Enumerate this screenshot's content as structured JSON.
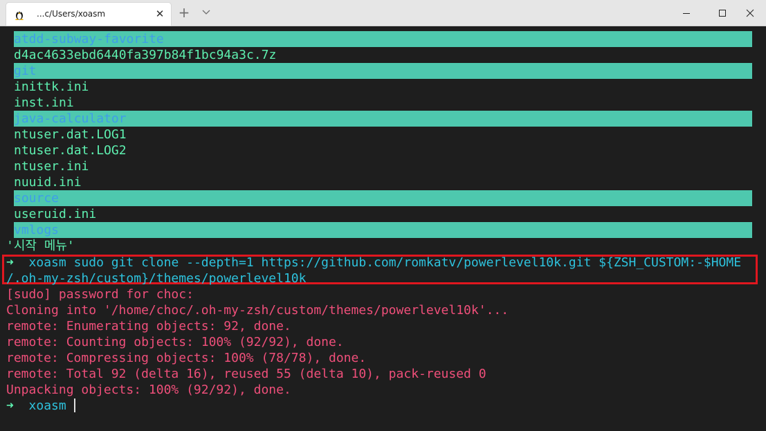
{
  "window": {
    "tab_title": "...c/Users/xoasm",
    "tab_icon": "linux-tux-icon",
    "close_tab_icon": "close-icon",
    "new_tab_symbol": "+",
    "dropdown_icon": "chevron-down-icon",
    "minimize_icon": "minimize-icon",
    "maximize_icon": "maximize-icon",
    "close_window_icon": "close-icon"
  },
  "colors": {
    "terminal_bg": "#1e1e1e",
    "dir_highlight": "#4ec8ae",
    "dir_text": "#3f9ee8",
    "file_text": "#5ef0b0",
    "output_text": "#ef4f7a",
    "prompt_user": "#2ec2dd",
    "annotation_box": "#e0171f"
  },
  "listing": [
    {
      "name": "atdd-subway-favorite",
      "is_dir": true
    },
    {
      "name": "d4ac4633ebd6440fa397b84f1bc94a3c.7z",
      "is_dir": false
    },
    {
      "name": "git",
      "is_dir": true
    },
    {
      "name": "inittk.ini",
      "is_dir": false
    },
    {
      "name": "inst.ini",
      "is_dir": false
    },
    {
      "name": "java-calculator",
      "is_dir": true
    },
    {
      "name": "ntuser.dat.LOG1",
      "is_dir": false
    },
    {
      "name": "ntuser.dat.LOG2",
      "is_dir": false
    },
    {
      "name": "ntuser.ini",
      "is_dir": false
    },
    {
      "name": "nuuid.ini",
      "is_dir": false
    },
    {
      "name": "source",
      "is_dir": true
    },
    {
      "name": "useruid.ini",
      "is_dir": false
    },
    {
      "name": "vmlogs",
      "is_dir": true
    }
  ],
  "korean_entry": "'시작 메뉴'",
  "command": {
    "arrow": "➜",
    "user": "xoasm",
    "line1": "sudo git clone --depth=1 https://github.com/romkatv/powerlevel10k.git ${ZSH_CUSTOM:-$HOME",
    "line2": "/.oh-my-zsh/custom}/themes/powerlevel10k"
  },
  "output": [
    "[sudo] password for choc:",
    "Cloning into '/home/choc/.oh-my-zsh/custom/themes/powerlevel10k'...",
    "remote: Enumerating objects: 92, done.",
    "remote: Counting objects: 100% (92/92), done.",
    "remote: Compressing objects: 100% (78/78), done.",
    "remote: Total 92 (delta 16), reused 55 (delta 10), pack-reused 0",
    "Unpacking objects: 100% (92/92), done."
  ],
  "final_prompt": {
    "arrow": "➜",
    "user": "xoasm"
  }
}
